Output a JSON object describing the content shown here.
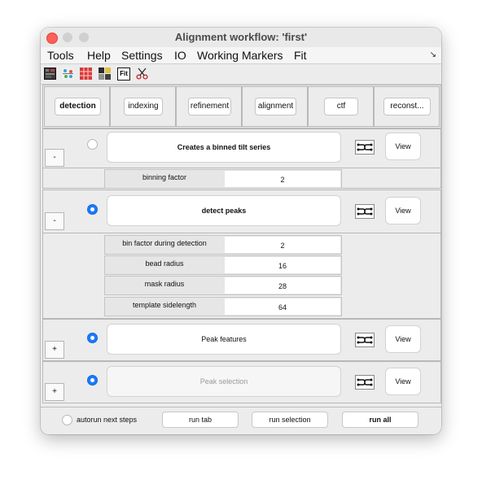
{
  "window": {
    "title": "Alignment workflow: 'first'"
  },
  "menu": {
    "items": [
      "Tools",
      "Help",
      "Settings",
      "IO",
      "Working Markers",
      "Fit"
    ],
    "overflow_icon": "double-arrow-icon"
  },
  "toolbar": {
    "icons": [
      "grid-view-icon",
      "marker-align-icon",
      "table-grid-icon",
      "tiles-icon",
      "fit-icon",
      "scissors-icon"
    ],
    "fit_label": "Fit"
  },
  "tabs": [
    "detection",
    "indexing",
    "refinement",
    "alignment",
    "ctf",
    "reconst..."
  ],
  "active_tab": "detection",
  "steps": {
    "binned": {
      "toggle": "-",
      "enabled": false,
      "label": "Creates a binned tilt series",
      "view": "View"
    },
    "detect": {
      "toggle": "-",
      "enabled": true,
      "label": "detect peaks",
      "view": "View"
    },
    "features": {
      "toggle": "+",
      "enabled": true,
      "label": "Peak features",
      "view": "View"
    },
    "selection": {
      "toggle": "+",
      "enabled": true,
      "label": "Peak selection",
      "view": "View"
    }
  },
  "binned_params": [
    {
      "label": "binning factor",
      "value": "2"
    }
  ],
  "detect_params": [
    {
      "label": "bin factor during detection",
      "value": "2"
    },
    {
      "label": "bead radius",
      "value": "16"
    },
    {
      "label": "mask radius",
      "value": "28"
    },
    {
      "label": "template sidelength",
      "value": "64"
    }
  ],
  "bottom": {
    "autorun_label": "autorun next steps",
    "run_tab": "run tab",
    "run_selection": "run selection",
    "run_all": "run all"
  },
  "colors": {
    "accent": "#1a7aff",
    "close": "#fe5f57"
  }
}
